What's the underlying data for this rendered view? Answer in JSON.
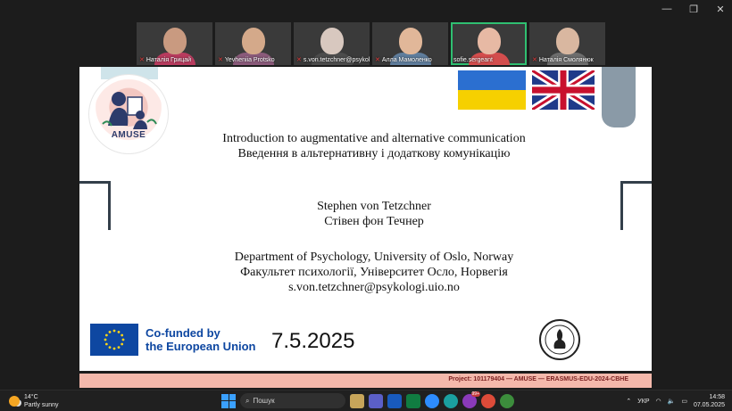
{
  "participants": [
    {
      "name": "Наталія Грицай",
      "muted": true,
      "face": "#c99a80",
      "shirt": "#b83b5e",
      "active": false
    },
    {
      "name": "Yevheniia Protsko",
      "muted": true,
      "face": "#d4a98a",
      "shirt": "#8a5a7a",
      "active": false
    },
    {
      "name": "s.von.tetzchner@psykolog...",
      "muted": true,
      "face": "#d8c8bf",
      "shirt": "#4c4c4c",
      "active": false
    },
    {
      "name": "Алла Мамоленко",
      "muted": true,
      "face": "#e1b799",
      "shirt": "#5f7d9c",
      "active": false
    },
    {
      "name": "sofie.sergeant",
      "muted": false,
      "face": "#e7b9a4",
      "shirt": "#d34d4d",
      "active": true
    },
    {
      "name": "Наталія Смолянюк",
      "muted": true,
      "face": "#d9b7a0",
      "shirt": "#6d6d6d",
      "active": false
    }
  ],
  "slide": {
    "logo_text": "AMUSE",
    "title_en": "Introduction to augmentative and alternative communication",
    "title_ua": "Введення в альтернативну і додаткову комунікацію",
    "author_en": "Stephen von Tetzchner",
    "author_ua": "Стівен фон Течнер",
    "dept_en": "Department of Psychology, University of Oslo, Norway",
    "dept_ua": "Факультет психології, Університет Осло, Норвегія",
    "email": "s.von.tetzchner@psykologi.uio.no",
    "eu_line1": "Co-funded by",
    "eu_line2": "the European Union",
    "date": "7.5.2025",
    "footer": "Project: 101179404 — AMUSE — ERASMUS-EDU-2024-CBHE"
  },
  "taskbar": {
    "temp": "14°C",
    "weather": "Partly sunny",
    "search_placeholder": "Пошук",
    "mail_badge": "99+",
    "lang": "УКР",
    "time": "14:58",
    "date": "07.05.2025"
  }
}
